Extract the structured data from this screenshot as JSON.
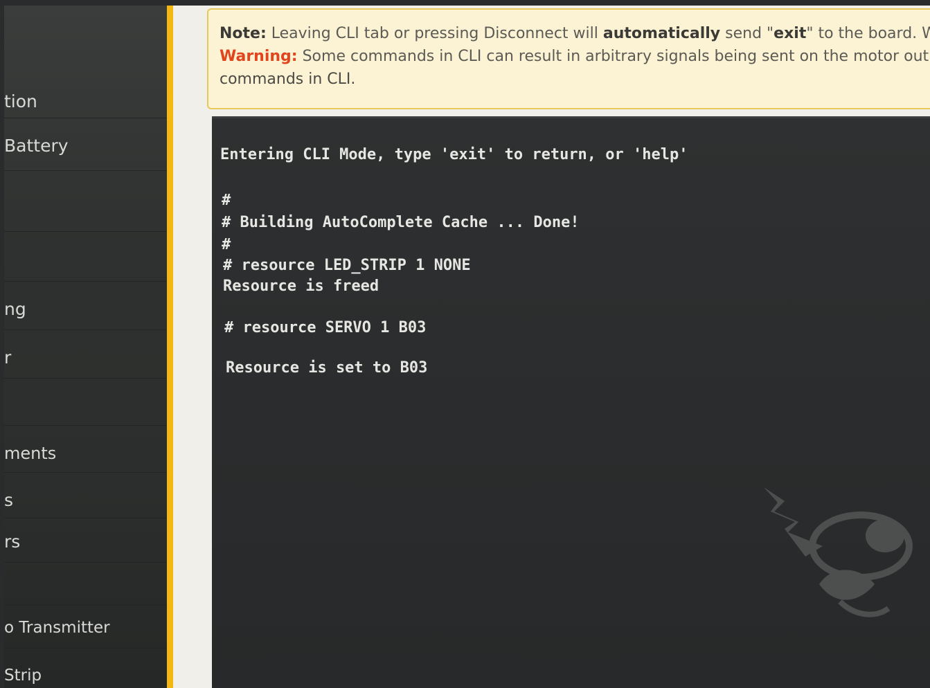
{
  "sidebar": {
    "items": [
      {
        "label": "tion"
      },
      {
        "label": "Battery"
      },
      {
        "label": ""
      },
      {
        "label": ""
      },
      {
        "label": "ng"
      },
      {
        "label": "r"
      },
      {
        "label": ""
      },
      {
        "label": "ments"
      },
      {
        "label": "s"
      },
      {
        "label": "rs"
      },
      {
        "label": ""
      },
      {
        "label": "o Transmitter"
      },
      {
        "label": "Strip"
      }
    ],
    "accent_color": "#f5b712"
  },
  "notice": {
    "note_label": "Note:",
    "note_text_1": " Leaving CLI tab or pressing Disconnect will ",
    "note_bold": "automatically",
    "note_text_2": " send \"",
    "note_exit": "exit",
    "note_text_3": "\" to the board. Wi",
    "warning_label": "Warning:",
    "warning_text": " Some commands in CLI can result in arbitrary signals being sent on the motor outp",
    "commands_text": "commands in CLI."
  },
  "cli": {
    "lines": [
      "Entering CLI Mode, type 'exit' to return, or 'help'",
      "",
      "#",
      "# Building AutoComplete Cache ... Done!",
      "#",
      "# resource LED_STRIP 1 NONE",
      "Resource is freed",
      "",
      "# resource SERVO 1 B03",
      "",
      "Resource is set to B03"
    ]
  },
  "colors": {
    "warning": "#e2451d",
    "note_bg": "#fbf3d3",
    "cli_bg": "#2b2d2e"
  },
  "icons": {
    "watermark": "hornet-logo-icon"
  }
}
